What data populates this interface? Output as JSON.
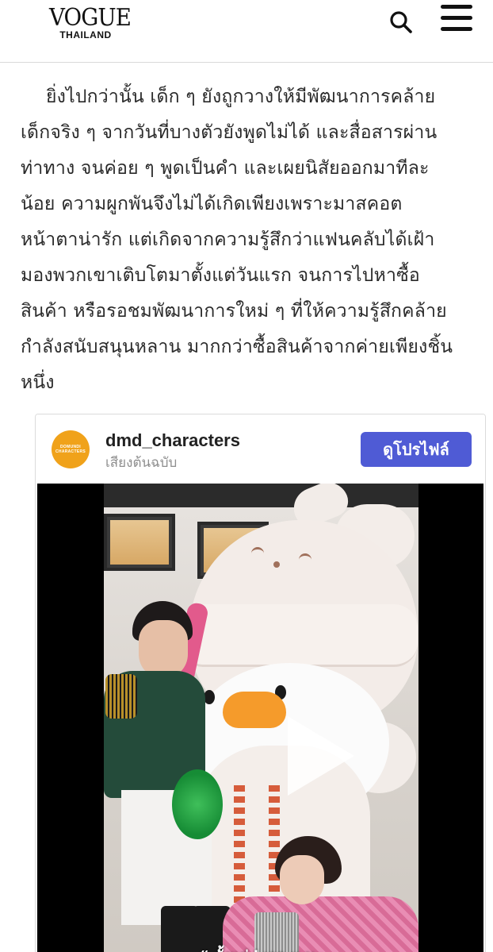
{
  "header": {
    "logo_main": "VOGUE",
    "logo_sub": "THAILAND",
    "search_icon": "search-icon",
    "menu_icon": "hamburger-menu-icon"
  },
  "article": {
    "lines": [
      "ยิ่งไปกว่านั้น เด็ก ๆ ยังถูกวางให้มีพัฒนาการคล้าย",
      "เด็กจริง ๆ จากวันที่บางตัวยังพูดไม่ได้ และสื่อสารผ่าน",
      "ท่าทาง จนค่อย ๆ พูดเป็นคำ และเผยนิสัยออกมาทีละ",
      "น้อย ความผูกพันจึงไม่ได้เกิดเพียงเพราะมาสคอต",
      "หน้าตาน่ารัก แต่เกิดจากความรู้สึกว่าแฟนคลับได้เฝ้า",
      "มองพวกเขาเติบโตมาตั้งแต่วันแรก จนการไปหาซื้อ",
      "สินค้า หรือรอชมพัฒนาการใหม่ ๆ ที่ให้ความรู้สึกคล้าย",
      "กำลังสนับสนุนหลาน มากกว่าซื้อสินค้าจากค่ายเพียงชิ้น",
      "หนึ่ง"
    ]
  },
  "embed": {
    "username": "dmd_characters",
    "subtitle": "เสียงต้นฉบับ",
    "profile_button": "ดูโปรไฟล์",
    "avatar_text_1": "DOMUNDI",
    "avatar_text_2": "CHARACTERS",
    "video_caption": "“ ตั้งแต่ i เจอ u นะ",
    "play_icon": "play-icon"
  },
  "colors": {
    "profile_button": "#4f5bd5",
    "avatar": "#f0a21a",
    "text": "#2a2a2a"
  }
}
